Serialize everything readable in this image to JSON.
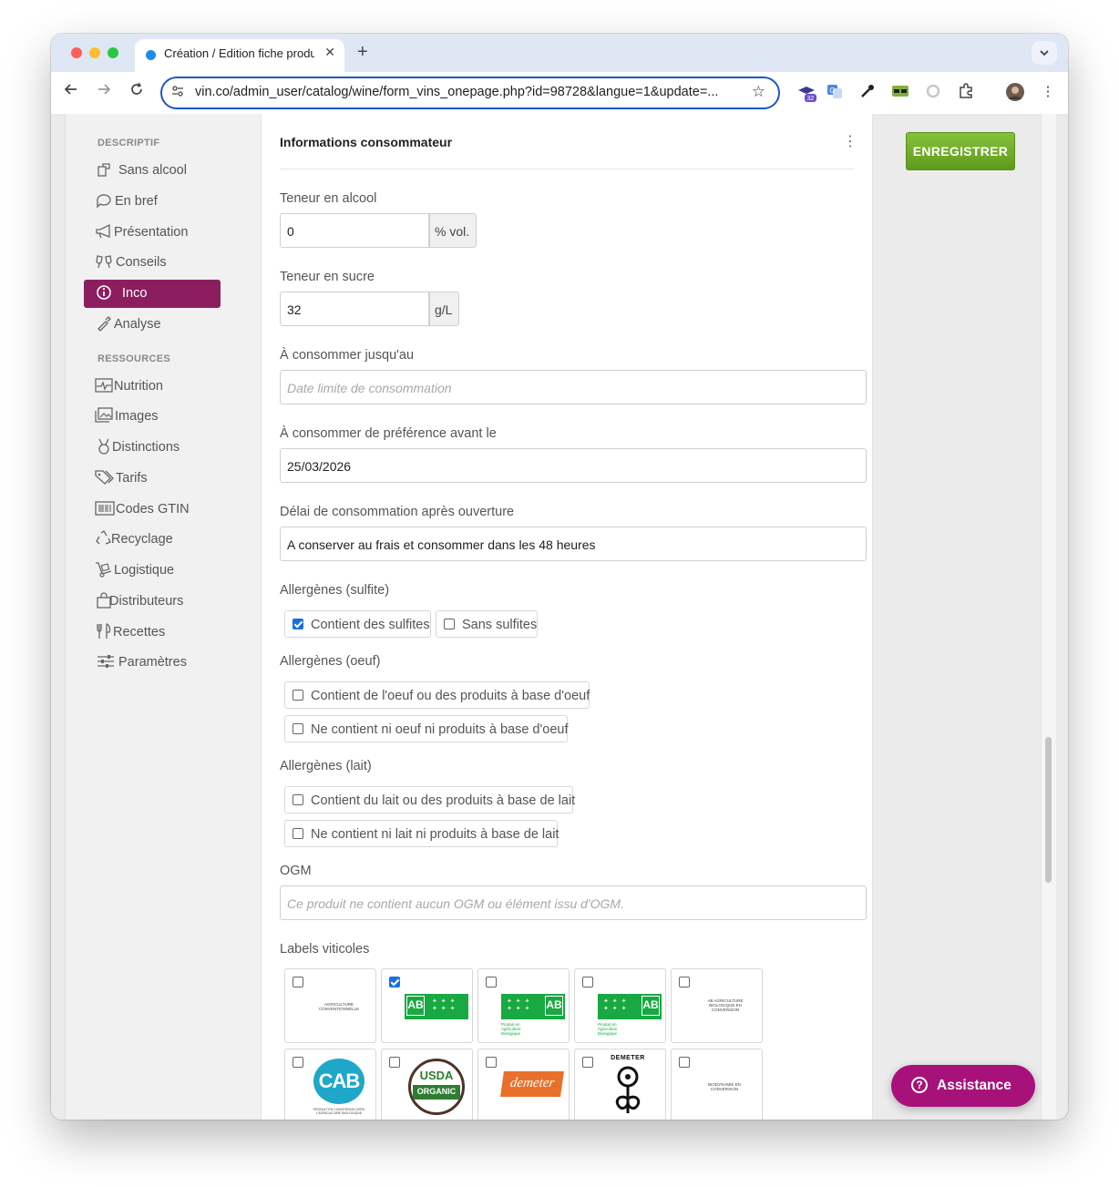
{
  "browser": {
    "tab_title": "Création / Edition fiche produit",
    "tab_close": "✕",
    "new_tab": "+",
    "url": "vin.co/admin_user/catalog/wine/form_vins_onepage.php?id=98728&langue=1&update=...",
    "extension_badge": "32"
  },
  "sidebar": {
    "section_descriptif": "DESCRIPTIF",
    "section_ressources": "RESSOURCES",
    "items": [
      {
        "label": "Sans alcool",
        "icon": "glass-icon"
      },
      {
        "label": "En bref",
        "icon": "chat-icon"
      },
      {
        "label": "Présentation",
        "icon": "megaphone-icon"
      },
      {
        "label": "Conseils",
        "icon": "cheers-icon"
      },
      {
        "label": "Inco",
        "icon": "info-icon",
        "active": true
      },
      {
        "label": "Analyse",
        "icon": "pipette-icon"
      },
      {
        "label": "Nutrition",
        "icon": "pulse-icon"
      },
      {
        "label": "Images",
        "icon": "images-icon"
      },
      {
        "label": "Distinctions",
        "icon": "medal-icon"
      },
      {
        "label": "Tarifs",
        "icon": "tags-icon"
      },
      {
        "label": "Codes GTIN",
        "icon": "barcode-icon"
      },
      {
        "label": "Recyclage",
        "icon": "recycle-icon"
      },
      {
        "label": "Logistique",
        "icon": "dolly-icon"
      },
      {
        "label": "Distributeurs",
        "icon": "bag-icon"
      },
      {
        "label": "Recettes",
        "icon": "utensils-icon"
      },
      {
        "label": "Paramètres",
        "icon": "sliders-icon"
      }
    ]
  },
  "form": {
    "title": "Informations consommateur",
    "alcool": {
      "label": "Teneur en alcool",
      "value": "0",
      "unit": "% vol."
    },
    "sucre": {
      "label": "Teneur en sucre",
      "value": "32",
      "unit": "g/L"
    },
    "dlc": {
      "label": "À consommer jusqu'au",
      "placeholder": "Date limite de consommation"
    },
    "ddm": {
      "label": "À consommer de préférence avant le",
      "value": "25/03/2026"
    },
    "delai": {
      "label": "Délai de consommation après ouverture",
      "value": "A conserver au frais et consommer dans les 48 heures"
    },
    "sulfite": {
      "label": "Allergènes (sulfite)",
      "option1": "Contient des sulfites",
      "option1_checked": true,
      "option2": "Sans sulfites",
      "option2_checked": false
    },
    "oeuf": {
      "label": "Allergènes (oeuf)",
      "option1": "Contient de l'oeuf ou des produits à base d'oeuf",
      "option2": "Ne contient ni oeuf ni produits à base d'oeuf"
    },
    "lait": {
      "label": "Allergènes (lait)",
      "option1": "Contient du lait ou des produits à base de lait",
      "option2": "Ne contient ni lait ni produits à base de lait"
    },
    "ogm": {
      "label": "OGM",
      "placeholder": "Ce produit ne contient aucun OGM ou élément issu d'OGM."
    },
    "labels": {
      "label": "Labels viticoles",
      "conventionnelle": "AGRICULTURE CONVENTIONNELLE",
      "ab_text": "AB",
      "ab_caption": "Produit en Agriculture Biologique",
      "ab_conversion": "AB AGRICULTURE BIOLOGIQUE EN CONVERSION",
      "cab": "CAB",
      "cab_caption": "PRODUIT EN CONVERSION VERS L'AGRICULTURE BIOLOGIQUE",
      "usda_top": "USDA",
      "usda_bottom": "ORGANIC",
      "demeter": "demeter",
      "demeter_round": "DEMETER",
      "biodynamie": "BIODYNAMIE EN CONVERSION"
    }
  },
  "actions": {
    "save": "ENREGISTRER",
    "assistance": "Assistance"
  }
}
